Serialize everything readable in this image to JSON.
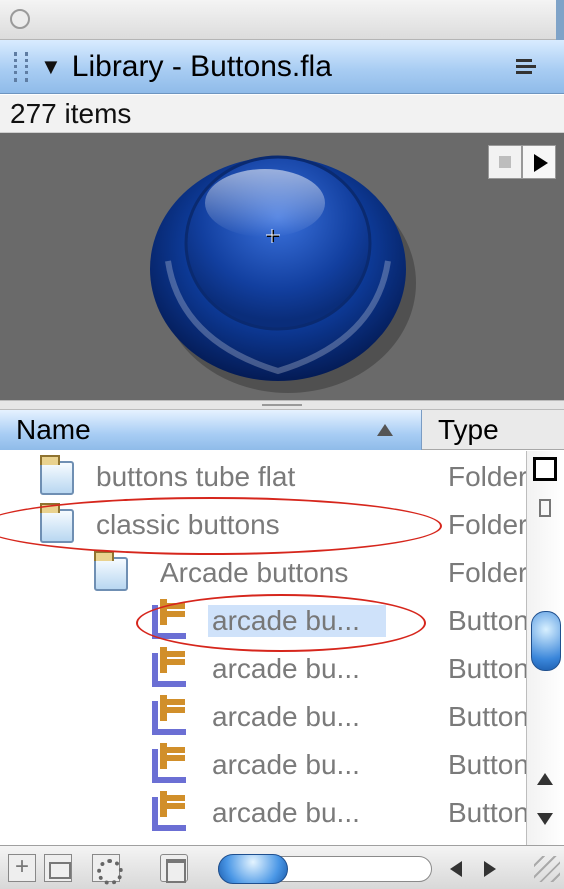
{
  "panel": {
    "title": "Library - Buttons.fla",
    "item_count": "277 items"
  },
  "columns": {
    "name": "Name",
    "type": "Type"
  },
  "items": [
    {
      "label": "buttons tube flat",
      "type": "Folder",
      "icon": "folder-icon"
    },
    {
      "label": "classic buttons",
      "type": "Folder",
      "icon": "folder-icon"
    },
    {
      "label": "Arcade buttons",
      "type": "Folder",
      "icon": "folder-icon"
    },
    {
      "label": "arcade bu...",
      "type": "Button",
      "icon": "button-symbol-icon",
      "selected": true
    },
    {
      "label": "arcade bu...",
      "type": "Button",
      "icon": "button-symbol-icon"
    },
    {
      "label": "arcade bu...",
      "type": "Button",
      "icon": "button-symbol-icon"
    },
    {
      "label": "arcade bu...",
      "type": "Button",
      "icon": "button-symbol-icon"
    },
    {
      "label": "arcade bu...",
      "type": "Button",
      "icon": "button-symbol-icon"
    }
  ],
  "colors": {
    "header_blue": "#a9cdf3",
    "preview_bg": "#6a6a6a",
    "selection": "#cfe2fa",
    "annotation_red": "#d6261c"
  },
  "icons": {
    "panel_menu": "list-menu-icon",
    "collapse": "triangle-down-icon",
    "stop": "stop-icon",
    "play": "play-icon",
    "sort": "sort-up-icon"
  }
}
